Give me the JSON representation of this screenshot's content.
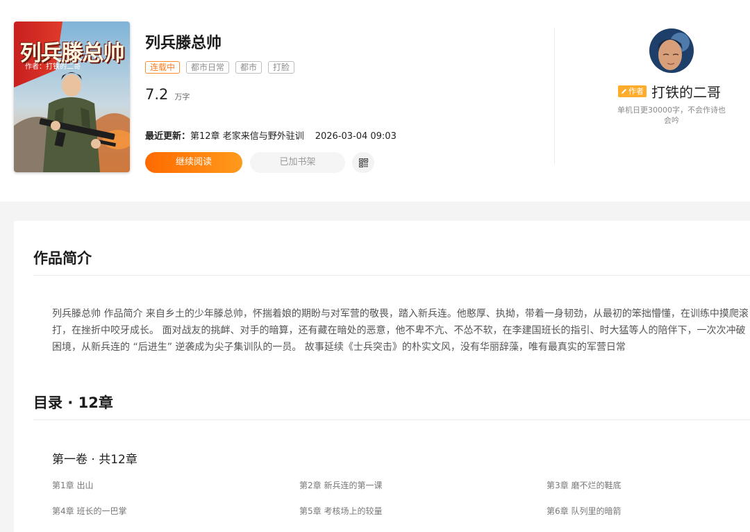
{
  "cover": {
    "title": "列兵滕总帅",
    "author_line": "作者：打铁的二哥"
  },
  "book": {
    "title": "列兵滕总帅",
    "status_tag": "连载中",
    "tags": [
      "都市日常",
      "都市",
      "打脸"
    ],
    "word_count": "7.2",
    "word_unit": "万字",
    "latest_label": "最近更新：",
    "latest_chapter": "第12章 老家来信与野外驻训",
    "latest_time": "2026-03-04 09:03"
  },
  "actions": {
    "read_label": "继续阅读",
    "shelf_label": "已加书架",
    "qr_icon": "qr-code-icon"
  },
  "author": {
    "badge": "作者",
    "name": "打铁的二哥",
    "bio": "单机日更30000字，不会作诗也会吟"
  },
  "intro": {
    "title": "作品简介",
    "text": "列兵滕总帅 作品简介 来自乡土的少年滕总帅，怀揣着娘的期盼与对军营的敬畏，踏入新兵连。他憨厚、执拗，带着一身韧劲，从最初的笨拙懵懂，在训练中摸爬滚打，在挫折中咬牙成长。 面对战友的挑衅、对手的暗算，还有藏在暗处的恶意，他不卑不亢、不怂不软，在李建国班长的指引、时大猛等人的陪伴下，一次次冲破困境，从新兵连的 “后进生” 逆袭成为尖子集训队的一员。 故事延续《士兵突击》的朴实文风，没有华丽辞藻，唯有最真实的军营日常"
  },
  "catalog": {
    "title": "目录 · 12章",
    "volume": "第一卷 · 共12章",
    "chapters": [
      "第1章 出山",
      "第2章 新兵连的第一课",
      "第3章 磨不烂的鞋底",
      "第4章 班长的一巴掌",
      "第5章 考核场上的较量",
      "第6章 队列里的暗箭"
    ]
  },
  "colors": {
    "accent": "#ff7b1a",
    "author_badge": "#ffab2c"
  }
}
